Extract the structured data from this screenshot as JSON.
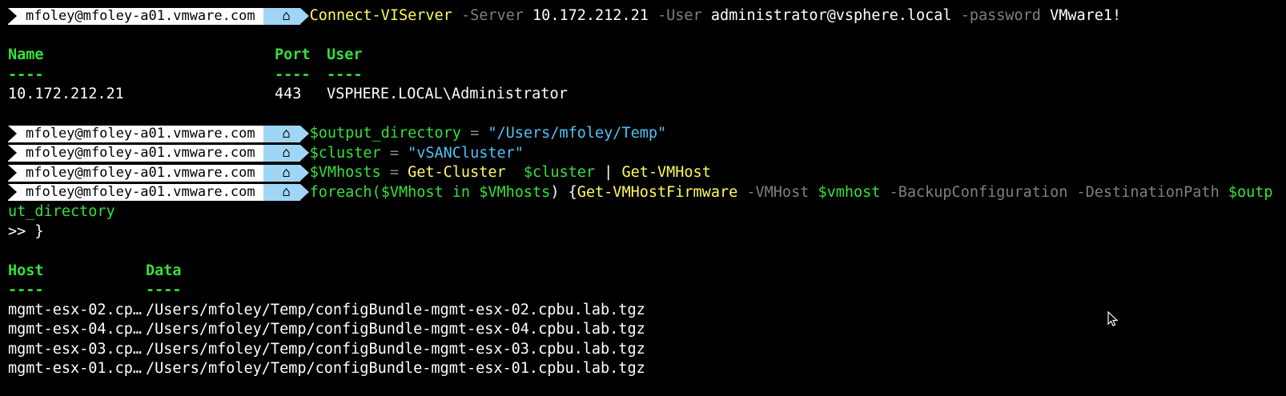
{
  "prompt": {
    "user_host": "mfoley@mfoley-a01.vmware.com",
    "dir_glyph": "⌂"
  },
  "commands": {
    "connect": {
      "cmdlet": "Connect-VIServer",
      "p1": "-Server",
      "v1": "10.172.212.21",
      "p2": "-User",
      "v2": "administrator@vsphere.local",
      "p3": "-password",
      "v3": "VMware1!"
    },
    "output_dir": {
      "var": "$output_directory",
      "op": "=",
      "str": "\"/Users/mfoley/Temp\""
    },
    "cluster": {
      "var": "$cluster",
      "op": "=",
      "str": "\"vSANCluster\""
    },
    "vmhosts": {
      "var": "$VMhosts",
      "op": "=",
      "cmd1": "Get-Cluster",
      "arg": "$cluster",
      "pipe": "|",
      "cmd2": "Get-VMHost"
    },
    "foreach": {
      "kw": "foreach(",
      "var1": "$VMhost",
      "in": "in",
      "var2": "$VMhosts",
      "close": ") {",
      "cmd": "Get-VMHostFirmware",
      "p1": "-VMHost",
      "v1": "$vmhost",
      "p2": "-BackupConfiguration",
      "p3": "-DestinationPath",
      "v3a": "$outp",
      "v3b": "ut_directory",
      "cont": ">> }"
    }
  },
  "connection_table": {
    "headers": [
      "Name",
      "Port",
      "User"
    ],
    "underlines": [
      "----",
      "----",
      "----"
    ],
    "rows": [
      [
        "10.172.212.21",
        "443",
        "VSPHERE.LOCAL\\Administrator"
      ]
    ]
  },
  "firmware_table": {
    "headers": [
      "Host",
      "Data"
    ],
    "underlines": [
      "----",
      "----"
    ],
    "rows": [
      [
        "mgmt-esx-02.cp…",
        "/Users/mfoley/Temp/configBundle-mgmt-esx-02.cpbu.lab.tgz"
      ],
      [
        "mgmt-esx-04.cp…",
        "/Users/mfoley/Temp/configBundle-mgmt-esx-04.cpbu.lab.tgz"
      ],
      [
        "mgmt-esx-03.cp…",
        "/Users/mfoley/Temp/configBundle-mgmt-esx-03.cpbu.lab.tgz"
      ],
      [
        "mgmt-esx-01.cp…",
        "/Users/mfoley/Temp/configBundle-mgmt-esx-01.cpbu.lab.tgz"
      ]
    ]
  },
  "colors": {
    "background": "#000000",
    "cmdlet": "#fffb5c",
    "variable": "#35e03a",
    "string": "#4fc3f7",
    "parameter": "#7f7f7f",
    "prompt_user_bg": "#ffffff",
    "prompt_dir_bg": "#9fd6f5"
  }
}
